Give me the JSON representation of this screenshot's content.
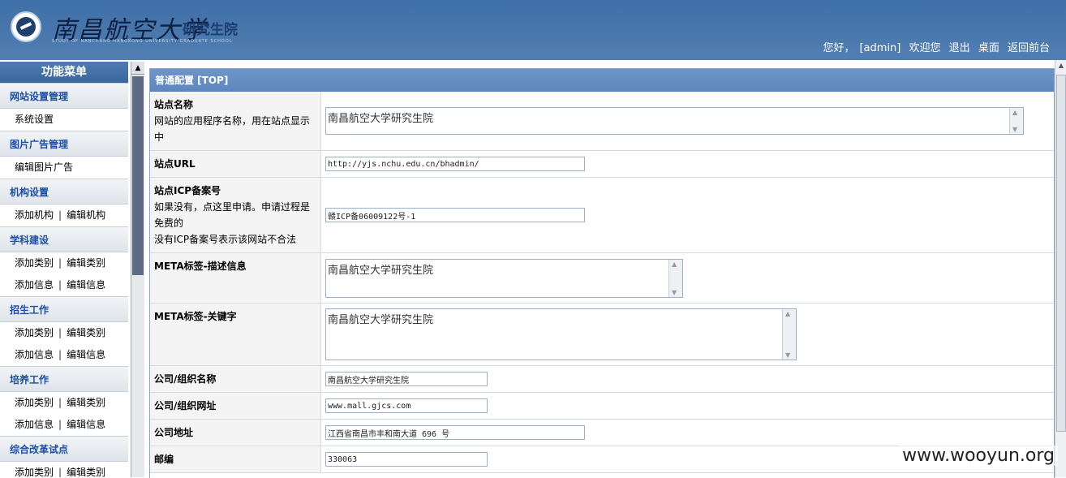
{
  "header": {
    "logo_cn": "南昌航空大学",
    "logo_sub": "研究生院",
    "logo_en": "STUDY OF NANCHANG HANGKONG UNIVERSITY GRADUATE SCHOOL",
    "greeting": "您好，",
    "user": "[admin]",
    "welcome": "欢迎您",
    "logout": "退出",
    "desktop": "桌面",
    "front": "返回前台"
  },
  "sidebar": {
    "title": "功能菜单",
    "groups": [
      {
        "label": "网站设置管理",
        "rows": [
          [
            "系统设置"
          ]
        ]
      },
      {
        "label": "图片广告管理",
        "rows": [
          [
            "编辑图片广告"
          ]
        ]
      },
      {
        "label": "机构设置",
        "rows": [
          [
            "添加机构",
            "编辑机构"
          ]
        ]
      },
      {
        "label": "学科建设",
        "rows": [
          [
            "添加类别",
            "编辑类别"
          ],
          [
            "添加信息",
            "编辑信息"
          ]
        ]
      },
      {
        "label": "招生工作",
        "rows": [
          [
            "添加类别",
            "编辑类别"
          ],
          [
            "添加信息",
            "编辑信息"
          ]
        ]
      },
      {
        "label": "培养工作",
        "rows": [
          [
            "添加类别",
            "编辑类别"
          ],
          [
            "添加信息",
            "编辑信息"
          ]
        ]
      },
      {
        "label": "综合改革试点",
        "rows": [
          [
            "添加类别",
            "编辑类别"
          ]
        ]
      }
    ],
    "separator": "|"
  },
  "main": {
    "section_title": "普通配置 [TOP]",
    "fields": {
      "site_name": {
        "label": "站点名称",
        "desc": "网站的应用程序名称，用在站点显示中",
        "value": "南昌航空大学研究生院"
      },
      "site_url": {
        "label": "站点URL",
        "value": "http://yjs.nchu.edu.cn/bhadmin/"
      },
      "icp": {
        "label": "站点ICP备案号",
        "desc1": "如果没有，点这里申请。申请过程是免费的",
        "desc2": "没有ICP备案号表示该网站不合法",
        "value": "赣ICP备06009122号-1"
      },
      "meta_desc": {
        "label": "META标签-描述信息",
        "value": "南昌航空大学研究生院"
      },
      "meta_kw": {
        "label": "META标签-关键字",
        "value": "南昌航空大学研究生院"
      },
      "org_name": {
        "label": "公司/组织名称",
        "value": "南昌航空大学研究生院"
      },
      "org_url": {
        "label": "公司/组织网址",
        "value": "www.mall.gjcs.com"
      },
      "address": {
        "label": "公司地址",
        "value": "江西省南昌市丰和南大道 696 号"
      },
      "zip": {
        "label": "邮编",
        "value": "330063"
      }
    }
  },
  "watermark": "www.wooyun.org"
}
